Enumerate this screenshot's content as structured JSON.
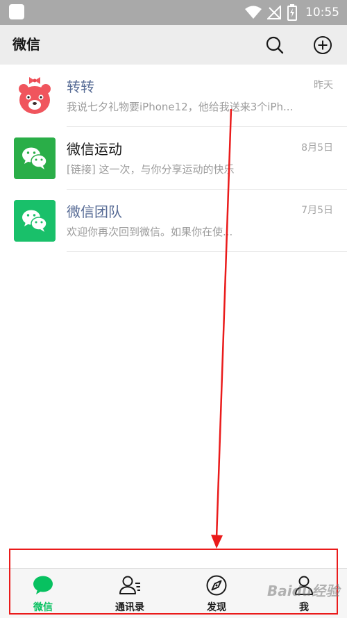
{
  "status_bar": {
    "time": "10:55"
  },
  "header": {
    "title": "微信"
  },
  "chats": [
    {
      "name": "转转",
      "preview": "我说七夕礼物要iPhone12，他给我送来3个iPh...",
      "time": "昨天",
      "name_color": "#576b95",
      "avatar": "zhuanzhuan-bear-logo"
    },
    {
      "name": "微信运动",
      "preview": "[链接] 这一次，与你分享运动的快乐",
      "time": "8月5日",
      "name_color": "#191919",
      "avatar": "wechat-sport-logo"
    },
    {
      "name": "微信团队",
      "preview": "欢迎你再次回到微信。如果你在使...",
      "time": "7月5日",
      "name_color": "#576b95",
      "avatar": "wechat-team-logo"
    }
  ],
  "bottom_nav": [
    {
      "label": "微信",
      "icon": "chat-bubble-icon",
      "active": true
    },
    {
      "label": "通讯录",
      "icon": "contacts-icon",
      "active": false
    },
    {
      "label": "发现",
      "icon": "compass-icon",
      "active": false
    },
    {
      "label": "我",
      "icon": "person-icon",
      "active": false
    }
  ],
  "watermark": {
    "text": "Baidu经验"
  },
  "colors": {
    "accent": "#07c160",
    "annotation": "#ea1b1b",
    "link_name": "#576b95"
  }
}
